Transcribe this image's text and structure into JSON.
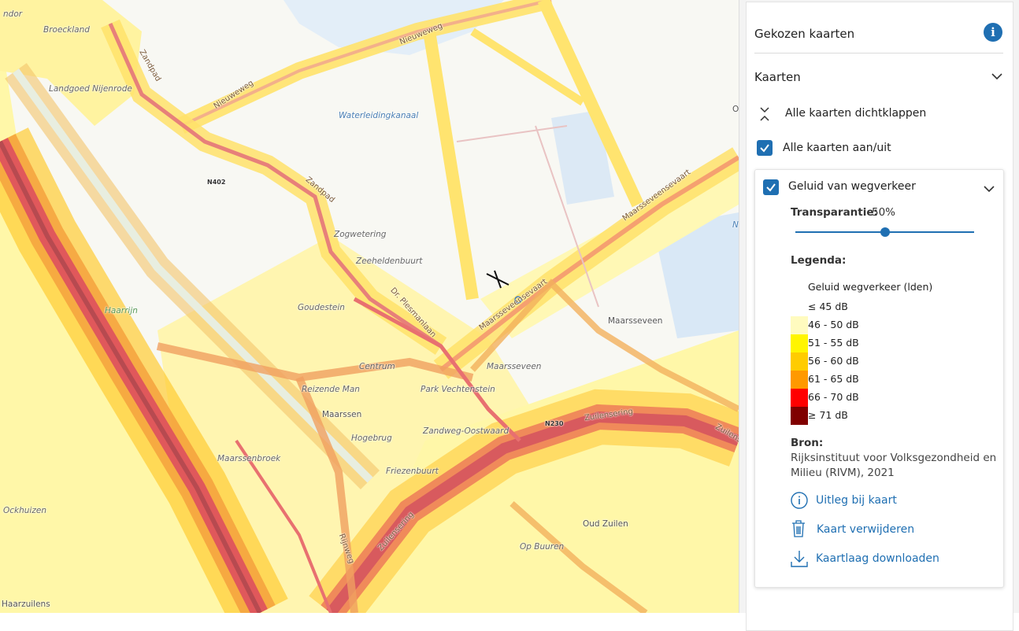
{
  "map": {
    "labels": {
      "broeckland": "Broeckland",
      "landgoed": "Landgoed Nijenrode",
      "zandpad1": "Zandpad",
      "nieuweweg1": "Nieuweweg",
      "nieuweweg2": "Nieuweweg",
      "waterleiding": "Waterleidingkanaal",
      "n402": "N402",
      "zandpad2": "Zandpad",
      "zogwetering": "Zogwetering",
      "zeeheldenbuurt": "Zeeheldenbuurt",
      "goudestein": "Goudestein",
      "haarrijn": "Haarrijn",
      "drplesmanlaan": "Dr. Plesmanlaan",
      "maarsseveensevaart1": "Maarsseveensevaart",
      "maarsseveensevaart2": "Maarsseveensevaart",
      "maarsseveen1": "Maarsseveen",
      "maarsseveen2": "Maarsseveen",
      "centrum": "Centrum",
      "reizendeman": "Reizende Man",
      "parkvechtenstein": "Park Vechtenstein",
      "maarssen": "Maarssen",
      "hogebrug": "Hogebrug",
      "zandwegoostwaard": "Zandweg-Oostwaard",
      "n230": "N230",
      "zuilensering1": "Zuilensering",
      "zuilensering2": "Zuilensering",
      "maarssenbroek": "Maarssenbroek",
      "friezenbuurt": "Friezenbuurt",
      "ockhuizen": "Ockhuizen",
      "oudzuilen": "Oud Zuilen",
      "opbuuren": "Op Buuren",
      "rijnweg": "Rijnweg",
      "haarzuilens": "Haarzuilens",
      "edge_ndor": "ndor",
      "edge_o": "O",
      "edge_n": "N"
    }
  },
  "panel": {
    "title": "Gekozen kaarten",
    "section_title": "Kaarten",
    "collapse_all": "Alle kaarten dichtklappen",
    "toggle_all": "Alle kaarten aan/uit",
    "layer": {
      "name": "Geluid van wegverkeer",
      "transparency_label": "Transparantie:",
      "transparency_value": "50%",
      "transparency_fraction": 0.5,
      "legend_label": "Legenda:",
      "legend_title": "Geluid wegverkeer (lden)",
      "legend_items": [
        {
          "label": "≤ 45 dB",
          "color": "#ffffff"
        },
        {
          "label": "46 - 50 dB",
          "color": "#fffbbf"
        },
        {
          "label": "51 - 55 dB",
          "color": "#fff500"
        },
        {
          "label": "56 - 60 dB",
          "color": "#ffcc00"
        },
        {
          "label": "61 - 65 dB",
          "color": "#ff9900"
        },
        {
          "label": "66 - 70 dB",
          "color": "#ff0000"
        },
        {
          "label": "≥ 71 dB",
          "color": "#800000"
        }
      ],
      "source_label": "Bron:",
      "source_line1": "Rijksinstituut voor Volksgezondheid en",
      "source_line2": "Milieu (RIVM), 2021",
      "link_explain": "Uitleg bij kaart",
      "link_remove": "Kaart verwijderen",
      "link_download": "Kaartlaag downloaden"
    },
    "accent": "#1f6fb2"
  }
}
